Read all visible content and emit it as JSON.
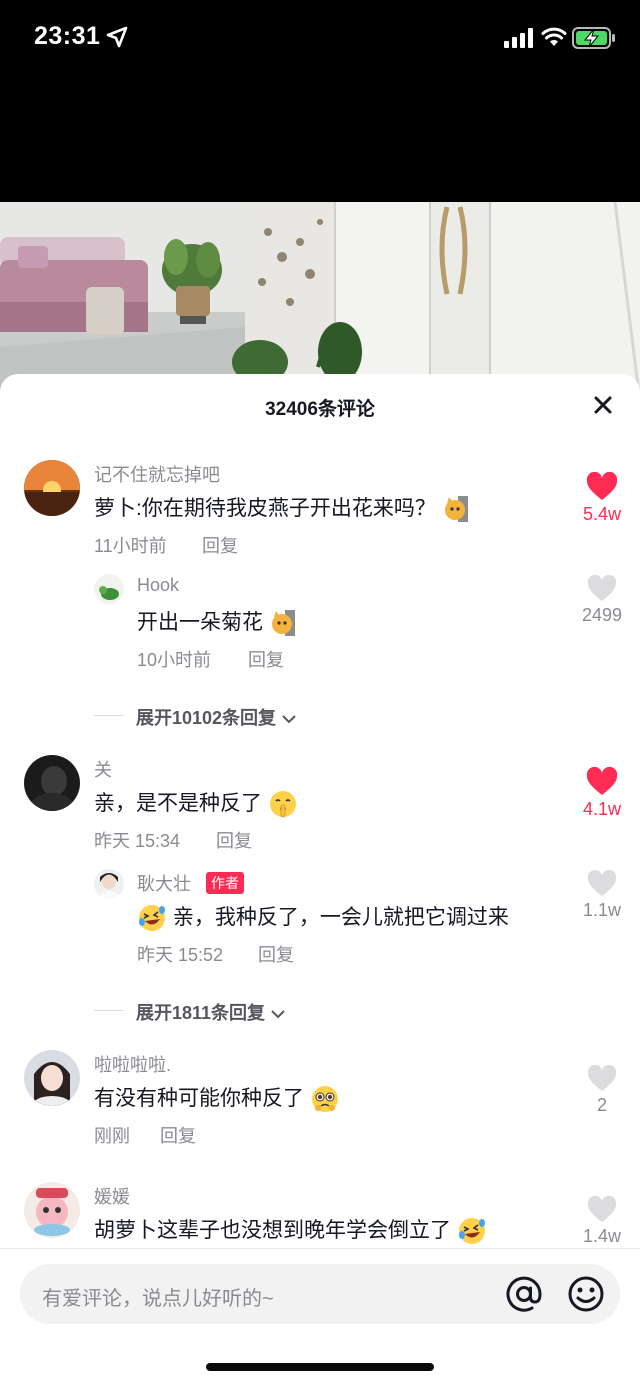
{
  "status_bar": {
    "time": "23:31"
  },
  "sheet": {
    "title": "32406条评论"
  },
  "comments": [
    {
      "user": "记不住就忘掉吧",
      "text": "萝卜:你在期待我皮燕子开出花来吗？",
      "time": "11小时前",
      "reply_label": "回复",
      "likes": "5.4w",
      "liked": true,
      "reply": {
        "user": "Hook",
        "text": "开出一朵菊花",
        "time": "10小时前",
        "reply_label": "回复",
        "likes": "2499",
        "liked": false
      },
      "expand_label": "展开10102条回复"
    },
    {
      "user": "关",
      "text": "亲，是不是种反了",
      "time": "昨天 15:34",
      "reply_label": "回复",
      "likes": "4.1w",
      "liked": true,
      "reply": {
        "user": "耿大壮",
        "badge": "作者",
        "text": "亲，我种反了，一会儿就把它调过来",
        "time": "昨天 15:52",
        "reply_label": "回复",
        "likes": "1.1w",
        "liked": false
      },
      "expand_label": "展开1811条回复"
    },
    {
      "user": "啦啦啦啦.",
      "text": "有没有种可能你种反了",
      "time": "刚刚",
      "reply_label": "回复",
      "likes": "2",
      "liked": false
    },
    {
      "user": "媛媛",
      "text": "胡萝卜这辈子也没想到晚年学会倒立了",
      "likes": "1.4w",
      "liked": false
    }
  ],
  "input": {
    "placeholder": "有爱评论，说点儿好听的~"
  },
  "colors": {
    "like_red": "#fe2c55",
    "muted_text": "#8a8b91",
    "main_text": "#161823"
  },
  "icons": [
    "location-arrow-icon",
    "signal-icon",
    "wifi-icon",
    "battery-charging-icon",
    "close-icon",
    "heart-icon",
    "at-icon",
    "emoji-face-icon",
    "chevron-down-icon"
  ]
}
